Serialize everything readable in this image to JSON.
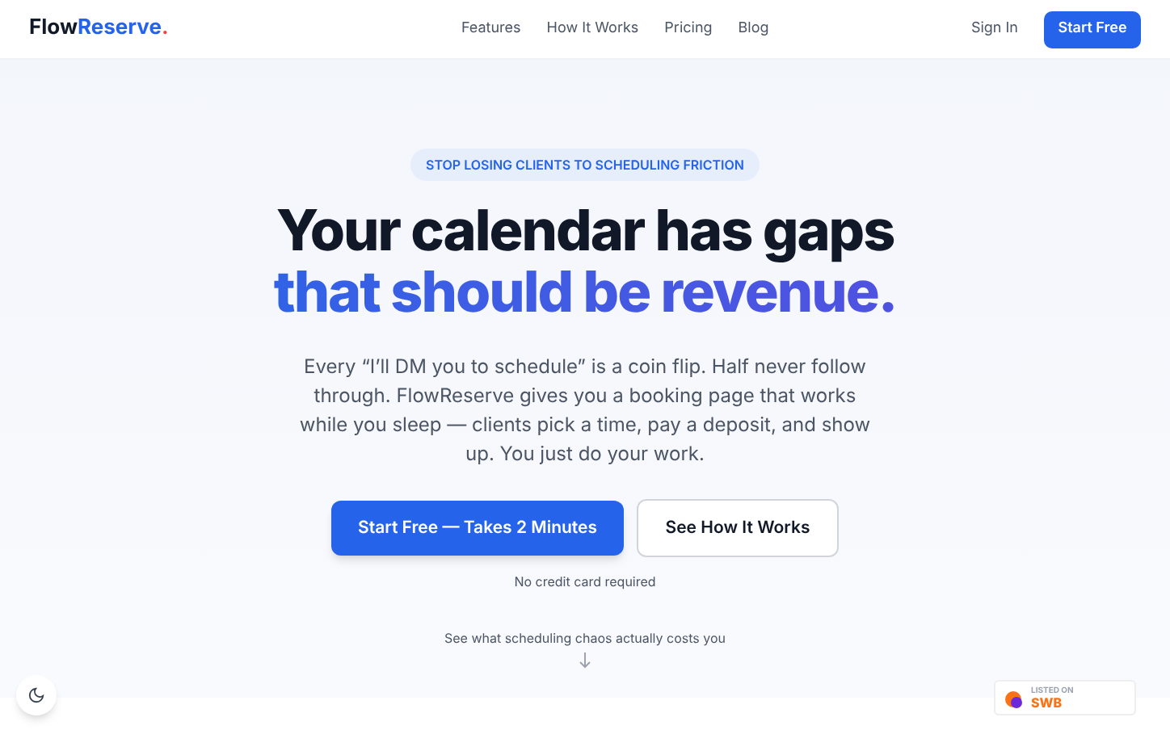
{
  "nav": {
    "logo": {
      "first": "Flow",
      "second": "Reserve",
      "dot": "."
    },
    "links": [
      "Features",
      "How It Works",
      "Pricing",
      "Blog"
    ],
    "sign_in": "Sign In",
    "cta": "Start Free"
  },
  "hero": {
    "eyebrow": "STOP LOSING CLIENTS TO SCHEDULING FRICTION",
    "title_line_1": "Your calendar has gaps",
    "title_line_2": "that should be revenue.",
    "body": "Every “I’ll DM you to schedule” is a coin flip. Half never follow through. FlowReserve gives you a booking page that works while you sleep — clients pick a time, pay a deposit, and show up. You just do your work.",
    "primary_button": "Start Free — Takes 2 Minutes",
    "secondary_button": "See How It Works",
    "note": "No credit card required",
    "scroll_hint": "See what scheduling chaos actually costs you"
  },
  "badge": {
    "small": "LISTED ON",
    "big": "SWB"
  }
}
